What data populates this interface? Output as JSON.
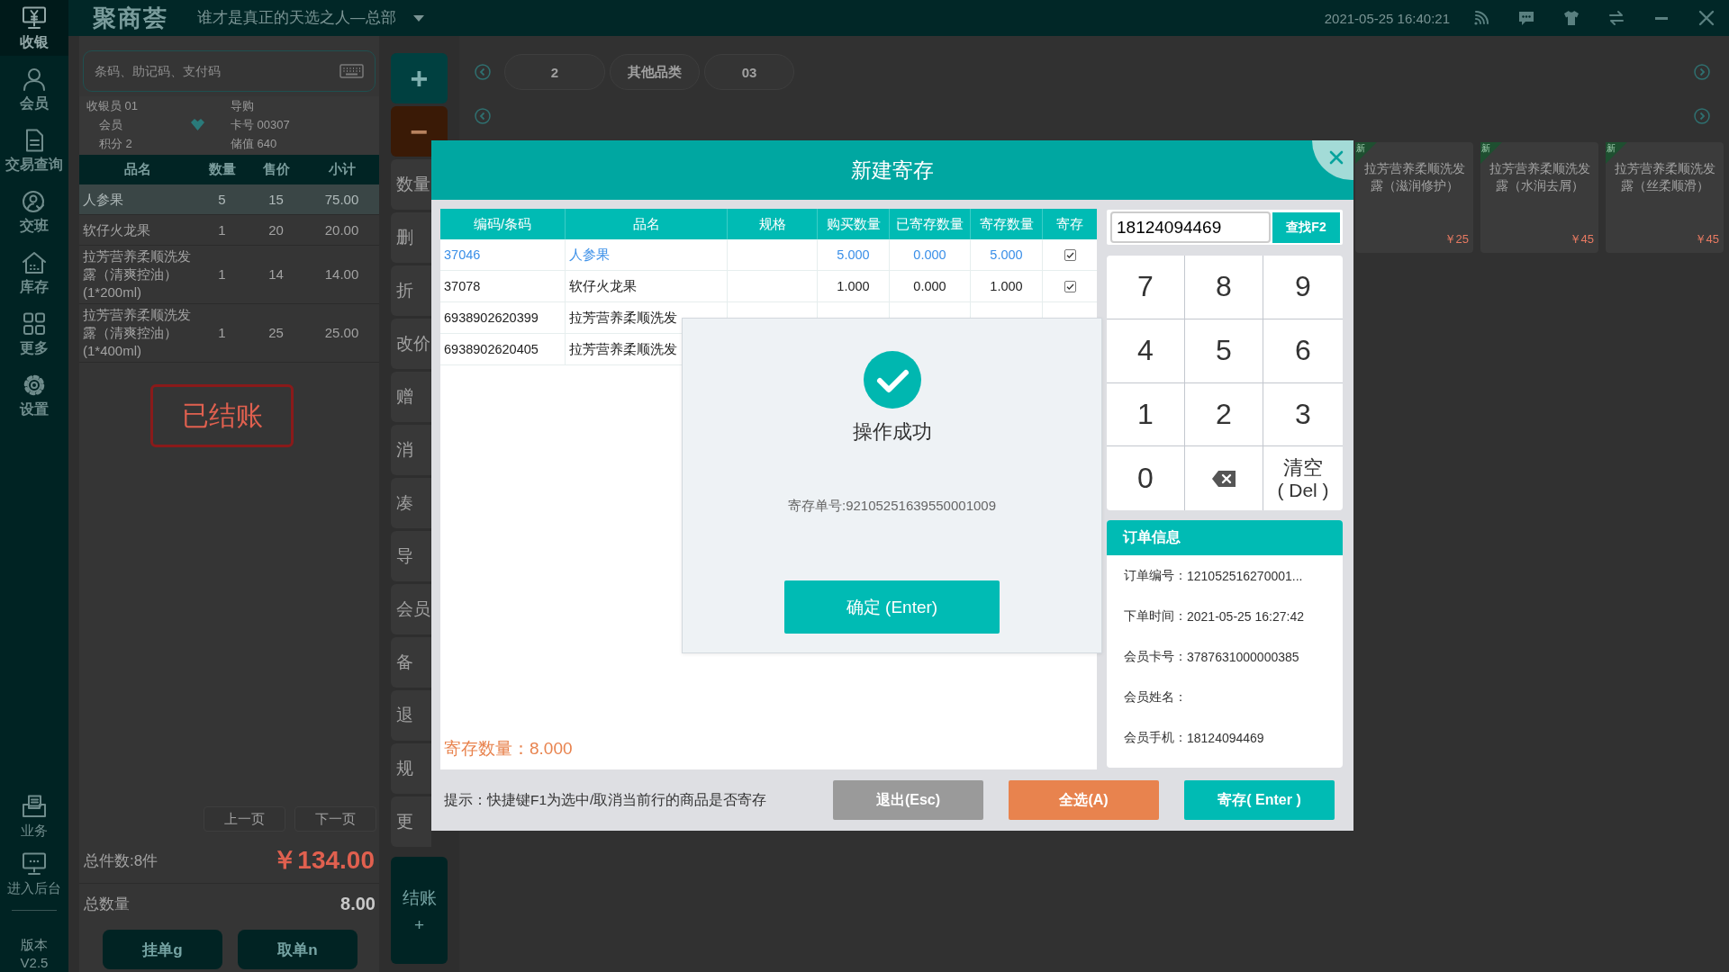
{
  "sidebar": {
    "items": [
      {
        "kind": "cashier",
        "label": "收银",
        "selected": true
      },
      {
        "kind": "member",
        "label": "会员",
        "selected": false
      },
      {
        "kind": "orders",
        "label": "交易查询",
        "selected": false
      },
      {
        "kind": "shift",
        "label": "交班",
        "selected": false
      },
      {
        "kind": "stock",
        "label": "库存",
        "selected": false
      },
      {
        "kind": "more",
        "label": "更多",
        "selected": false
      },
      {
        "kind": "settings",
        "label": "设置",
        "selected": false
      }
    ],
    "bottom_items": [
      {
        "kind": "business",
        "label": "业务"
      },
      {
        "kind": "backend",
        "label": "进入后台"
      }
    ],
    "version_label": "版本",
    "version": "V2.5"
  },
  "top_bar": {
    "logo": "聚商荟",
    "store": "谁才是真正的天选之人—总部",
    "datetime": "2021-05-25 16:40:21"
  },
  "cart_panel": {
    "search": {
      "placeholder": "条码、助记码、支付码"
    },
    "info": {
      "cashier": "收银员 01",
      "guide": "导购",
      "member": "会员",
      "card": "卡号 00307",
      "points": "积分 2",
      "balance": "储值 640"
    },
    "columns": [
      "品名",
      "数量",
      "售价",
      "小计"
    ],
    "rows": [
      {
        "name": "人参果",
        "qty": "5",
        "price": "15",
        "subtotal": "75.00",
        "selected": true
      },
      {
        "name": "软仔火龙果",
        "qty": "1",
        "price": "20",
        "subtotal": "20.00",
        "selected": false
      },
      {
        "name": "拉芳营养柔顺洗发露（清爽控油）(1*200ml)",
        "qty": "1",
        "price": "14",
        "subtotal": "14.00",
        "selected": false
      },
      {
        "name": "拉芳营养柔顺洗发露（清爽控油）(1*400ml)",
        "qty": "1",
        "price": "25",
        "subtotal": "25.00",
        "selected": false
      }
    ],
    "stamp": "已结账",
    "pager": [
      "上一页",
      "下一页"
    ],
    "total_items": "总件数:8件",
    "total_amount": "￥134.00",
    "total_qty_label": "总数量",
    "total_qty": "8.00",
    "actions": [
      "挂单g",
      "取单n"
    ]
  },
  "action_column": {
    "add": "+",
    "remove": "−",
    "buttons": [
      "数量",
      "删",
      "折",
      "改价",
      "赠",
      "消",
      "凑",
      "导",
      "会员",
      "备",
      "退",
      "规",
      "更"
    ],
    "checkout": {
      "label": "结账",
      "sub": "+"
    }
  },
  "products": {
    "categories": [
      "2",
      "其他品类",
      "03"
    ],
    "cards": [
      {
        "tag": "新",
        "name": "拉芳营养柔顺洗发露（滋润修护）",
        "price": "￥25"
      },
      {
        "tag": "新",
        "name": "拉芳营养柔顺洗发露（水润去屑）",
        "price": "￥45"
      },
      {
        "tag": "新",
        "name": "拉芳营养柔顺洗发露（丝柔顺滑）",
        "price": "￥45"
      }
    ]
  },
  "deposit_dialog": {
    "title": "新建寄存",
    "table": {
      "columns": [
        "编码/条码",
        "品名",
        "规格",
        "购买数量",
        "已寄存数量",
        "寄存数量",
        "寄存"
      ],
      "rows": [
        {
          "code": "37046",
          "name": "人参果",
          "bought": "5.000",
          "stored": "0.000",
          "deposit": "5.000",
          "checked": true,
          "selected": true
        },
        {
          "code": "37078",
          "name": "软仔火龙果",
          "bought": "1.000",
          "stored": "0.000",
          "deposit": "1.000",
          "checked": true,
          "selected": false
        },
        {
          "code": "6938902620399",
          "name": "拉芳营养柔顺洗发",
          "selected": false
        },
        {
          "code": "6938902620405",
          "name": "拉芳营养柔顺洗发",
          "selected": false
        }
      ]
    },
    "deposit_total": "寄存数量：8.000",
    "hint": "提示：快捷键F1为选中/取消当前行的商品是否寄存",
    "buttons": [
      {
        "kind": "exit",
        "label": "退出(Esc)"
      },
      {
        "kind": "select_all",
        "label": "全选(A)"
      },
      {
        "kind": "deposit",
        "label": "寄存( Enter )"
      }
    ],
    "lookup": {
      "value": "18124094469",
      "button": "查找F2"
    },
    "keypad": [
      {
        "kind": "digit",
        "label": "7"
      },
      {
        "kind": "digit",
        "label": "8"
      },
      {
        "kind": "digit",
        "label": "9"
      },
      {
        "kind": "digit",
        "label": "4"
      },
      {
        "kind": "digit",
        "label": "5"
      },
      {
        "kind": "digit",
        "label": "6"
      },
      {
        "kind": "digit",
        "label": "1"
      },
      {
        "kind": "digit",
        "label": "2"
      },
      {
        "kind": "digit",
        "label": "3"
      },
      {
        "kind": "digit",
        "label": "0"
      },
      {
        "kind": "backspace"
      },
      {
        "kind": "clear",
        "label": "清空",
        "sub": "( Del )"
      }
    ],
    "order_info": {
      "title": "订单信息",
      "fields": [
        {
          "label": "订单编号：",
          "value": "121052516270001..."
        },
        {
          "label": "下单时间：",
          "value": "2021-05-25 16:27:42"
        },
        {
          "label": "会员卡号：",
          "value": "3787631000000385"
        },
        {
          "label": "会员姓名："
        },
        {
          "label": "会员手机：",
          "value": "18124094469"
        }
      ]
    }
  },
  "success_popup": {
    "title": "操作成功",
    "message": "寄存单号:92105251639550001009",
    "button": "确定 (Enter)"
  }
}
